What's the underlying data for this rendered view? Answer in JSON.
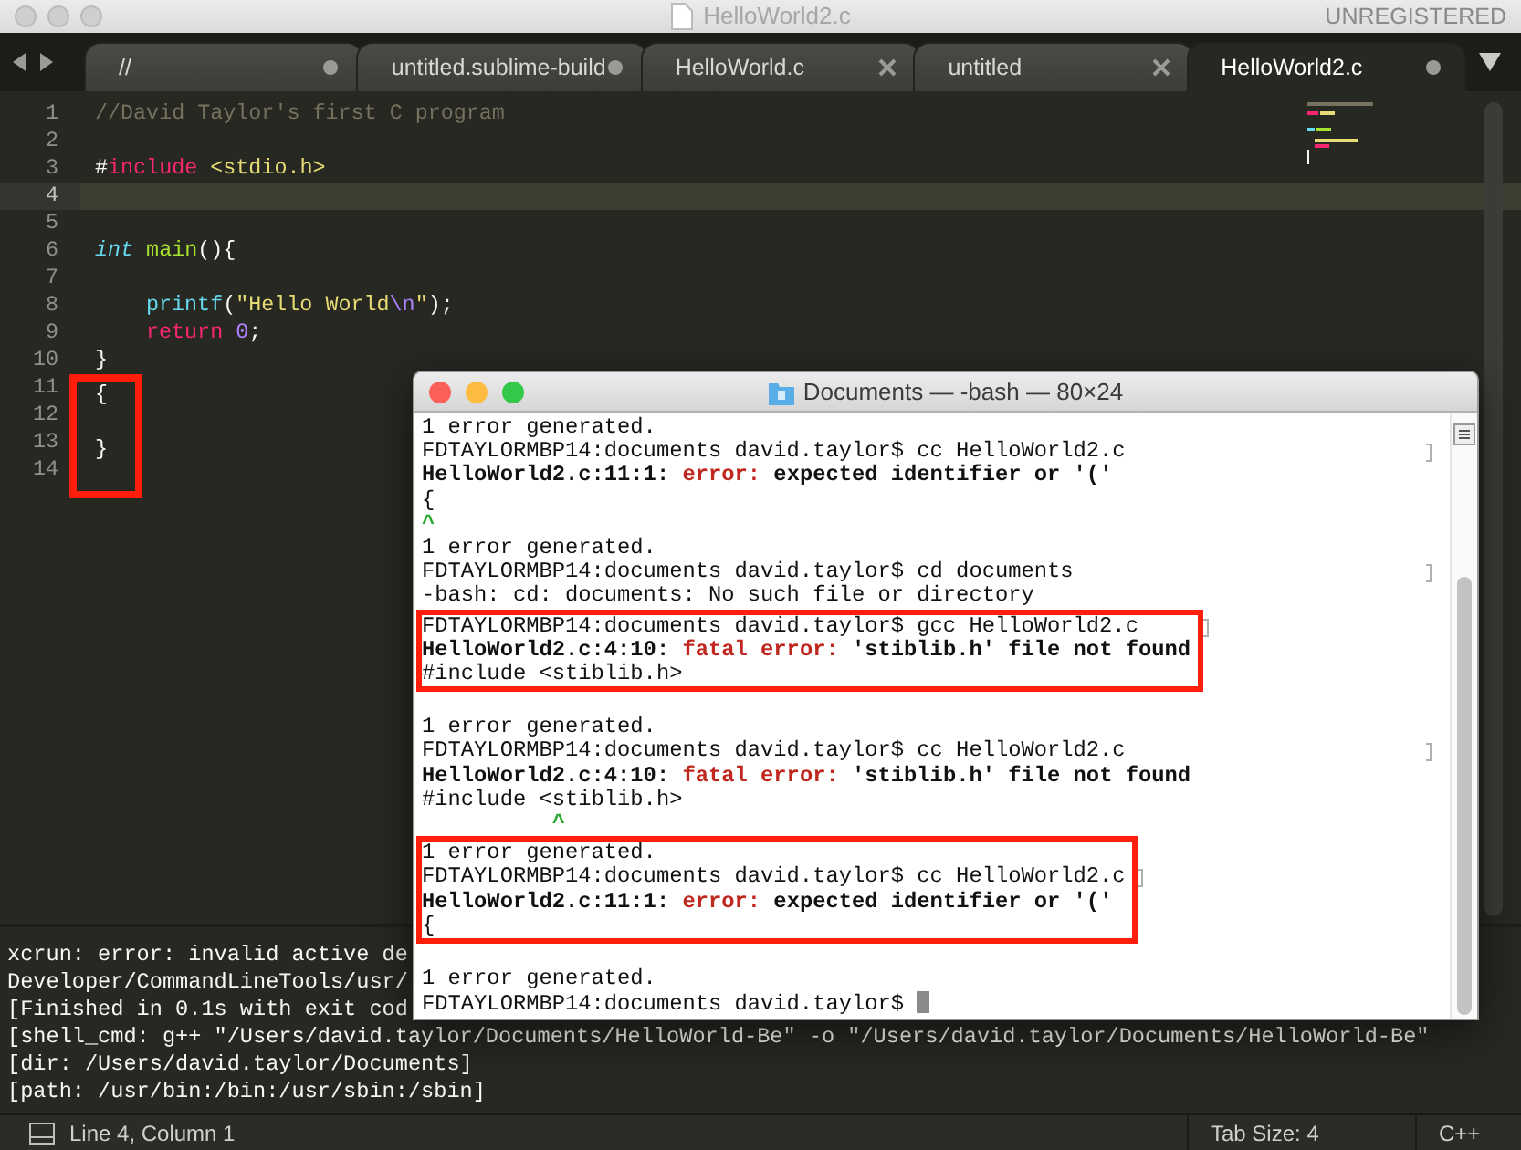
{
  "window": {
    "title": "HelloWorld2.c",
    "badge": "UNREGISTERED"
  },
  "tabs": [
    {
      "label": "//",
      "selected": false,
      "dirty": true
    },
    {
      "label": "untitled.sublime-build",
      "selected": false,
      "dirty": true
    },
    {
      "label": "HelloWorld.c",
      "selected": false,
      "dirty": false
    },
    {
      "label": "untitled",
      "selected": false,
      "dirty": false
    },
    {
      "label": "HelloWorld2.c",
      "selected": true,
      "dirty": true
    }
  ],
  "editor": {
    "lines": [
      {
        "number": "1",
        "current": false,
        "boxed": false,
        "indented": false,
        "tokens": [
          {
            "text": "//David Taylor's first C program",
            "kind": "comment"
          }
        ]
      },
      {
        "number": "2",
        "current": false,
        "boxed": false
      },
      {
        "number": "3",
        "current": false,
        "boxed": false,
        "indented": false,
        "tokens": [
          {
            "text": "#",
            "kind": "plain"
          },
          {
            "text": "include",
            "kind": "keyword"
          },
          {
            "text": " <stdio.h>",
            "kind": "string"
          }
        ]
      },
      {
        "number": "4",
        "current": true,
        "boxed": false
      },
      {
        "number": "5",
        "current": false,
        "boxed": false
      },
      {
        "number": "6",
        "current": false,
        "boxed": false,
        "indented": false,
        "tokens": [
          {
            "text": "int",
            "kind": "storage"
          },
          {
            "text": " main",
            "kind": "func"
          },
          {
            "text": "(){",
            "kind": "plain"
          }
        ]
      },
      {
        "number": "7",
        "current": false,
        "boxed": false
      },
      {
        "number": "8",
        "current": false,
        "boxed": false,
        "indented": true,
        "tokens": [
          {
            "text": "printf",
            "kind": "support"
          },
          {
            "text": "(",
            "kind": "plain"
          },
          {
            "text": "\"Hello World",
            "kind": "string"
          },
          {
            "text": "\\n",
            "kind": "escape"
          },
          {
            "text": "\"",
            "kind": "string"
          },
          {
            "text": ");",
            "kind": "plain"
          }
        ]
      },
      {
        "number": "9",
        "current": false,
        "boxed": false,
        "indented": true,
        "tokens": [
          {
            "text": "return",
            "kind": "keyword"
          },
          {
            "text": " 0",
            "kind": "number"
          },
          {
            "text": ";",
            "kind": "plain"
          }
        ]
      },
      {
        "number": "10",
        "current": false,
        "boxed": false,
        "indented": false,
        "tokens": [
          {
            "text": "}",
            "kind": "plain"
          }
        ]
      },
      {
        "number": "11",
        "current": false,
        "boxed": true,
        "indented": false,
        "tokens": [
          {
            "text": "{",
            "kind": "plain"
          }
        ]
      },
      {
        "number": "12",
        "current": false,
        "boxed": true
      },
      {
        "number": "13",
        "current": false,
        "boxed": true,
        "indented": false,
        "tokens": [
          {
            "text": "}",
            "kind": "plain"
          }
        ]
      },
      {
        "number": "14",
        "current": false,
        "boxed": true
      }
    ]
  },
  "build_output": {
    "lines": [
      "xcrun: error: invalid active de",
      "Developer/CommandLineTools/usr/",
      "[Finished in 0.1s with exit cod",
      "[shell_cmd: g++ \"/Users/david.taylor/Documents/HelloWorld-Be\" -o \"/Users/david.taylor/Documents/HelloWorld-Be\"",
      "[dir: /Users/david.taylor/Documents]",
      "[path: /usr/bin:/bin:/usr/sbin:/sbin]"
    ]
  },
  "status_bar": {
    "position": "Line 4, Column 1",
    "tab_size": "Tab Size: 4",
    "syntax": "C++"
  },
  "terminal": {
    "title": "Documents — -bash — 80×24",
    "lines": [
      {
        "kind": "text",
        "boxed": false,
        "marked": false,
        "cursor": false,
        "segments": [
          {
            "text": "1 error generated.",
            "kind": "plain"
          }
        ]
      },
      {
        "kind": "text",
        "boxed": false,
        "marked": true,
        "cursor": false,
        "segments": [
          {
            "text": "FDTAYLORMBP14:documents david.taylor$ cc HelloWorld2.c",
            "kind": "plain"
          }
        ]
      },
      {
        "kind": "text",
        "boxed": false,
        "marked": false,
        "cursor": false,
        "segments": [
          {
            "text": "HelloWorld2.c:11:1: ",
            "kind": "bold"
          },
          {
            "text": "error:",
            "kind": "error"
          },
          {
            "text": " expected identifier or '('",
            "kind": "bold"
          }
        ]
      },
      {
        "kind": "text",
        "boxed": false,
        "marked": false,
        "cursor": false,
        "segments": [
          {
            "text": "{",
            "kind": "plain"
          }
        ]
      },
      {
        "kind": "caret",
        "boxed": false,
        "marked": false,
        "cursor": false,
        "segments": [
          {
            "text": "^",
            "kind": "plain"
          }
        ]
      },
      {
        "kind": "text",
        "boxed": false,
        "marked": false,
        "cursor": false,
        "segments": [
          {
            "text": "1 error generated.",
            "kind": "plain"
          }
        ]
      },
      {
        "kind": "text",
        "boxed": false,
        "marked": true,
        "cursor": false,
        "segments": [
          {
            "text": "FDTAYLORMBP14:documents david.taylor$ cd documents",
            "kind": "plain"
          }
        ]
      },
      {
        "kind": "text",
        "boxed": false,
        "marked": false,
        "cursor": false,
        "segments": [
          {
            "text": "-bash: cd: documents: No such file or directory",
            "kind": "plain"
          }
        ]
      },
      {
        "kind": "text",
        "boxed": true,
        "marked": true,
        "cursor": false,
        "segments": [
          {
            "text": "FDTAYLORMBP14:documents david.taylor$ gcc HelloWorld2.c",
            "kind": "plain"
          }
        ]
      },
      {
        "kind": "text",
        "boxed": true,
        "marked": false,
        "cursor": false,
        "segments": [
          {
            "text": "HelloWorld2.c:4:10: ",
            "kind": "bold"
          },
          {
            "text": "fatal error:",
            "kind": "error"
          },
          {
            "text": " 'stiblib.h' file not found",
            "kind": "bold"
          }
        ]
      },
      {
        "kind": "text",
        "boxed": true,
        "marked": false,
        "cursor": false,
        "segments": [
          {
            "text": "#include <stiblib.h>",
            "kind": "plain"
          }
        ]
      },
      {
        "kind": "text",
        "boxed": false,
        "marked": false
      },
      {
        "kind": "text",
        "boxed": false,
        "marked": false,
        "cursor": false,
        "segments": [
          {
            "text": "1 error generated.",
            "kind": "plain"
          }
        ]
      },
      {
        "kind": "text",
        "boxed": false,
        "marked": true,
        "cursor": false,
        "segments": [
          {
            "text": "FDTAYLORMBP14:documents david.taylor$ cc HelloWorld2.c",
            "kind": "plain"
          }
        ]
      },
      {
        "kind": "text",
        "boxed": false,
        "marked": false,
        "cursor": false,
        "segments": [
          {
            "text": "HelloWorld2.c:4:10: ",
            "kind": "bold"
          },
          {
            "text": "fatal error:",
            "kind": "error"
          },
          {
            "text": " 'stiblib.h' file not found",
            "kind": "bold"
          }
        ]
      },
      {
        "kind": "text",
        "boxed": false,
        "marked": false,
        "cursor": false,
        "segments": [
          {
            "text": "#include <stiblib.h>",
            "kind": "plain"
          }
        ]
      },
      {
        "kind": "caret",
        "boxed": false,
        "marked": false,
        "cursor": false,
        "segments": [
          {
            "text": "          ^",
            "kind": "plain"
          }
        ]
      },
      {
        "kind": "text",
        "boxed": true,
        "marked": false,
        "cursor": false,
        "segments": [
          {
            "text": "1 error generated.",
            "kind": "plain"
          }
        ]
      },
      {
        "kind": "text",
        "boxed": true,
        "marked": true,
        "cursor": false,
        "segments": [
          {
            "text": "FDTAYLORMBP14:documents david.taylor$ cc HelloWorld2.c",
            "kind": "plain"
          }
        ]
      },
      {
        "kind": "text",
        "boxed": true,
        "marked": false,
        "cursor": false,
        "segments": [
          {
            "text": "HelloWorld2.c:11:1: ",
            "kind": "bold"
          },
          {
            "text": "error:",
            "kind": "error"
          },
          {
            "text": " expected identifier or '('",
            "kind": "bold"
          }
        ]
      },
      {
        "kind": "text",
        "boxed": true,
        "marked": false,
        "cursor": false,
        "segments": [
          {
            "text": "{",
            "kind": "plain"
          }
        ]
      },
      {
        "kind": "text",
        "boxed": false,
        "marked": false
      },
      {
        "kind": "text",
        "boxed": false,
        "marked": false,
        "cursor": false,
        "segments": [
          {
            "text": "1 error generated.",
            "kind": "plain"
          }
        ]
      },
      {
        "kind": "text",
        "boxed": false,
        "marked": false,
        "cursor": true,
        "segments": [
          {
            "text": "FDTAYLORMBP14:documents david.taylor$",
            "kind": "plain"
          }
        ]
      }
    ]
  }
}
